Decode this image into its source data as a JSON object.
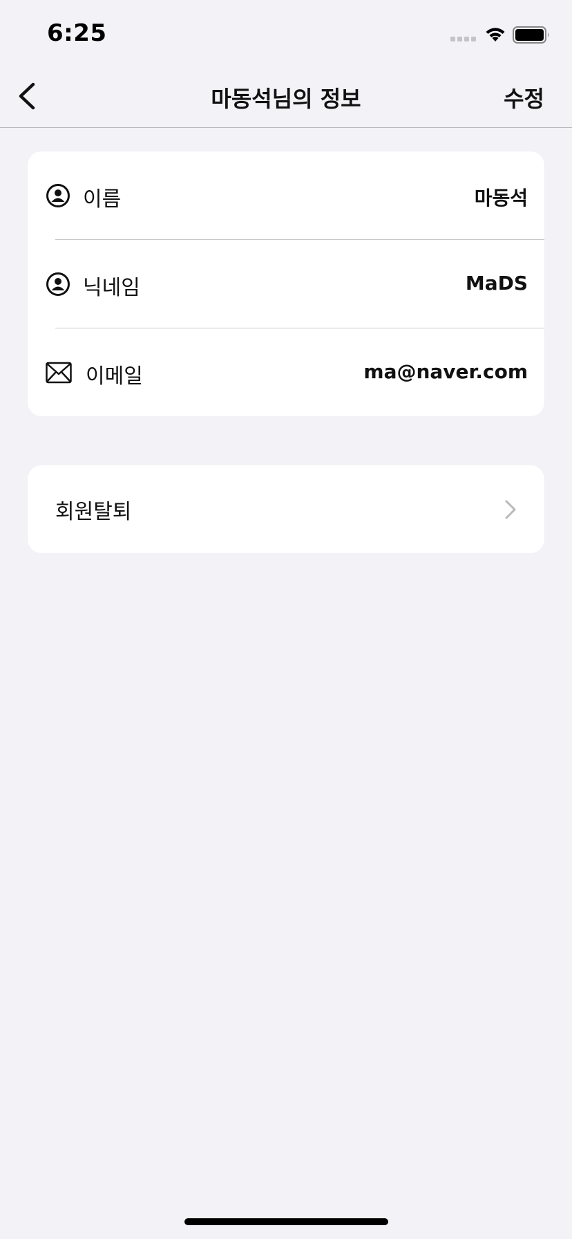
{
  "status_bar": {
    "time": "6:25",
    "icons": [
      "signal-icon",
      "wifi-icon",
      "battery-icon"
    ]
  },
  "nav": {
    "back_icon": "chevron-left-icon",
    "title": "마동석님의 정보",
    "edit_label": "수정"
  },
  "profile": {
    "rows": [
      {
        "icon": "user-circle-icon",
        "label": "이름",
        "value": "마동석"
      },
      {
        "icon": "user-circle-icon",
        "label": "닉네임",
        "value": "MaDS"
      },
      {
        "icon": "envelope-icon",
        "label": "이메일",
        "value": "ma@naver.com"
      }
    ]
  },
  "account": {
    "withdraw_label": "회원탈퇴",
    "withdraw_icon": "chevron-right-icon"
  },
  "colors": {
    "background": "#f2f2f7",
    "card": "#ffffff",
    "text": "#111111",
    "divider": "#c8c8cc",
    "chevron": "#b8b8bd"
  }
}
